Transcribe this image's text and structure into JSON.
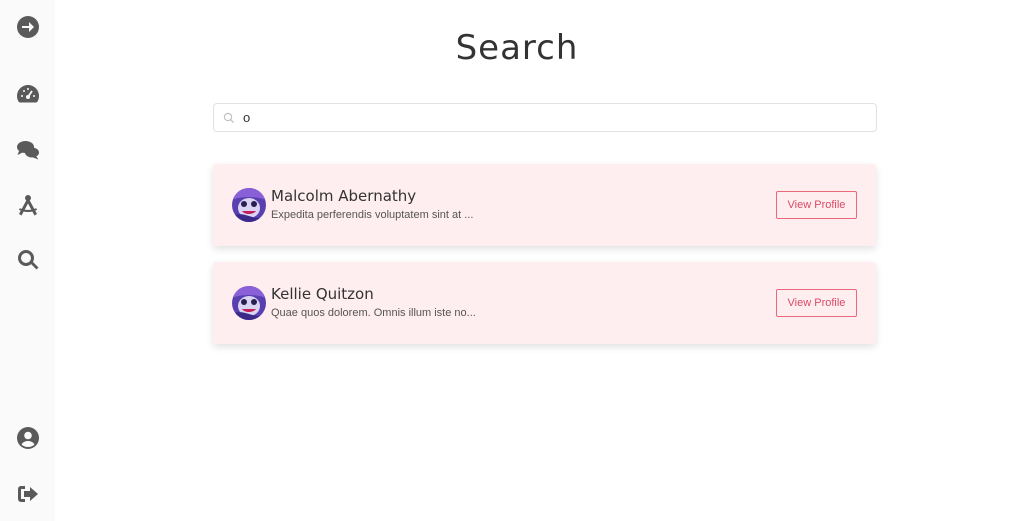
{
  "sidebar": {
    "items": [
      {
        "icon": "arrow-right-circle-icon"
      },
      {
        "icon": "dashboard-gauge-icon"
      },
      {
        "icon": "comments-icon"
      },
      {
        "icon": "drafting-compass-icon"
      },
      {
        "icon": "search-icon"
      }
    ],
    "bottom_items": [
      {
        "icon": "user-circle-icon"
      },
      {
        "icon": "sign-out-icon"
      }
    ]
  },
  "page": {
    "title": "Search"
  },
  "search": {
    "value": "o",
    "icon": "search-icon"
  },
  "results": [
    {
      "name": "Malcolm Abernathy",
      "description": "Expedita perferendis voluptatem sint at ...",
      "button_label": "View Profile"
    },
    {
      "name": "Kellie Quitzon",
      "description": "Quae quos dolorem. Omnis illum iste no...",
      "button_label": "View Profile"
    }
  ],
  "colors": {
    "card_background": "#ffeef0",
    "button_accent": "#e8697e",
    "icon_gray": "#5a5a5a"
  }
}
